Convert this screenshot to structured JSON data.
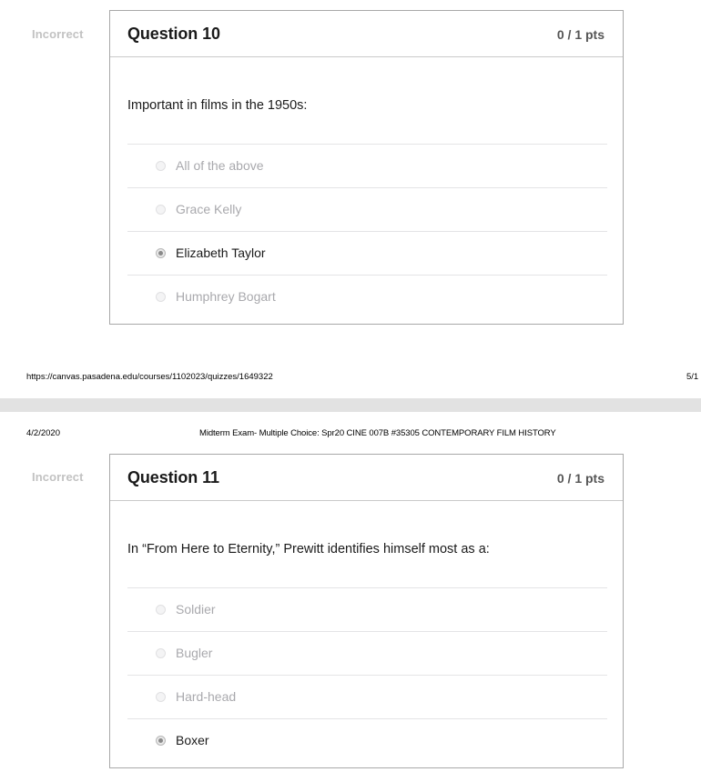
{
  "accent_colors": {
    "card_border": "#a8a8a8",
    "divider": "#e4e4e6",
    "incorrect_text": "#c2c2c2",
    "points_text": "#555555",
    "unselected_answer_text": "#a9a9ad",
    "selected_answer_text": "#1a1a1a",
    "page_gap_band": "#e2e2e2"
  },
  "page_one": {
    "question": {
      "flag_label": "Incorrect",
      "title": "Question 10",
      "points": "0 / 1 pts",
      "prompt": "Important in films in the 1950s:",
      "answers": [
        {
          "label": "All of the above",
          "selected": false
        },
        {
          "label": "Grace Kelly",
          "selected": false
        },
        {
          "label": "Elizabeth Taylor",
          "selected": true
        },
        {
          "label": "Humphrey Bogart",
          "selected": false
        }
      ]
    },
    "footer": {
      "url": "https://canvas.pasadena.edu/courses/1102023/quizzes/1649322",
      "page_marker": "5/1"
    }
  },
  "page_two": {
    "header": {
      "date": "4/2/2020",
      "document_title": "Midterm Exam- Multiple Choice: Spr20 CINE 007B #35305 CONTEMPORARY FILM HISTORY"
    },
    "question": {
      "flag_label": "Incorrect",
      "title": "Question 11",
      "points": "0 / 1 pts",
      "prompt": "In “From Here to Eternity,” Prewitt identifies himself most as a:",
      "answers": [
        {
          "label": "Soldier",
          "selected": false
        },
        {
          "label": "Bugler",
          "selected": false
        },
        {
          "label": "Hard-head",
          "selected": false
        },
        {
          "label": "Boxer",
          "selected": true
        }
      ]
    }
  }
}
